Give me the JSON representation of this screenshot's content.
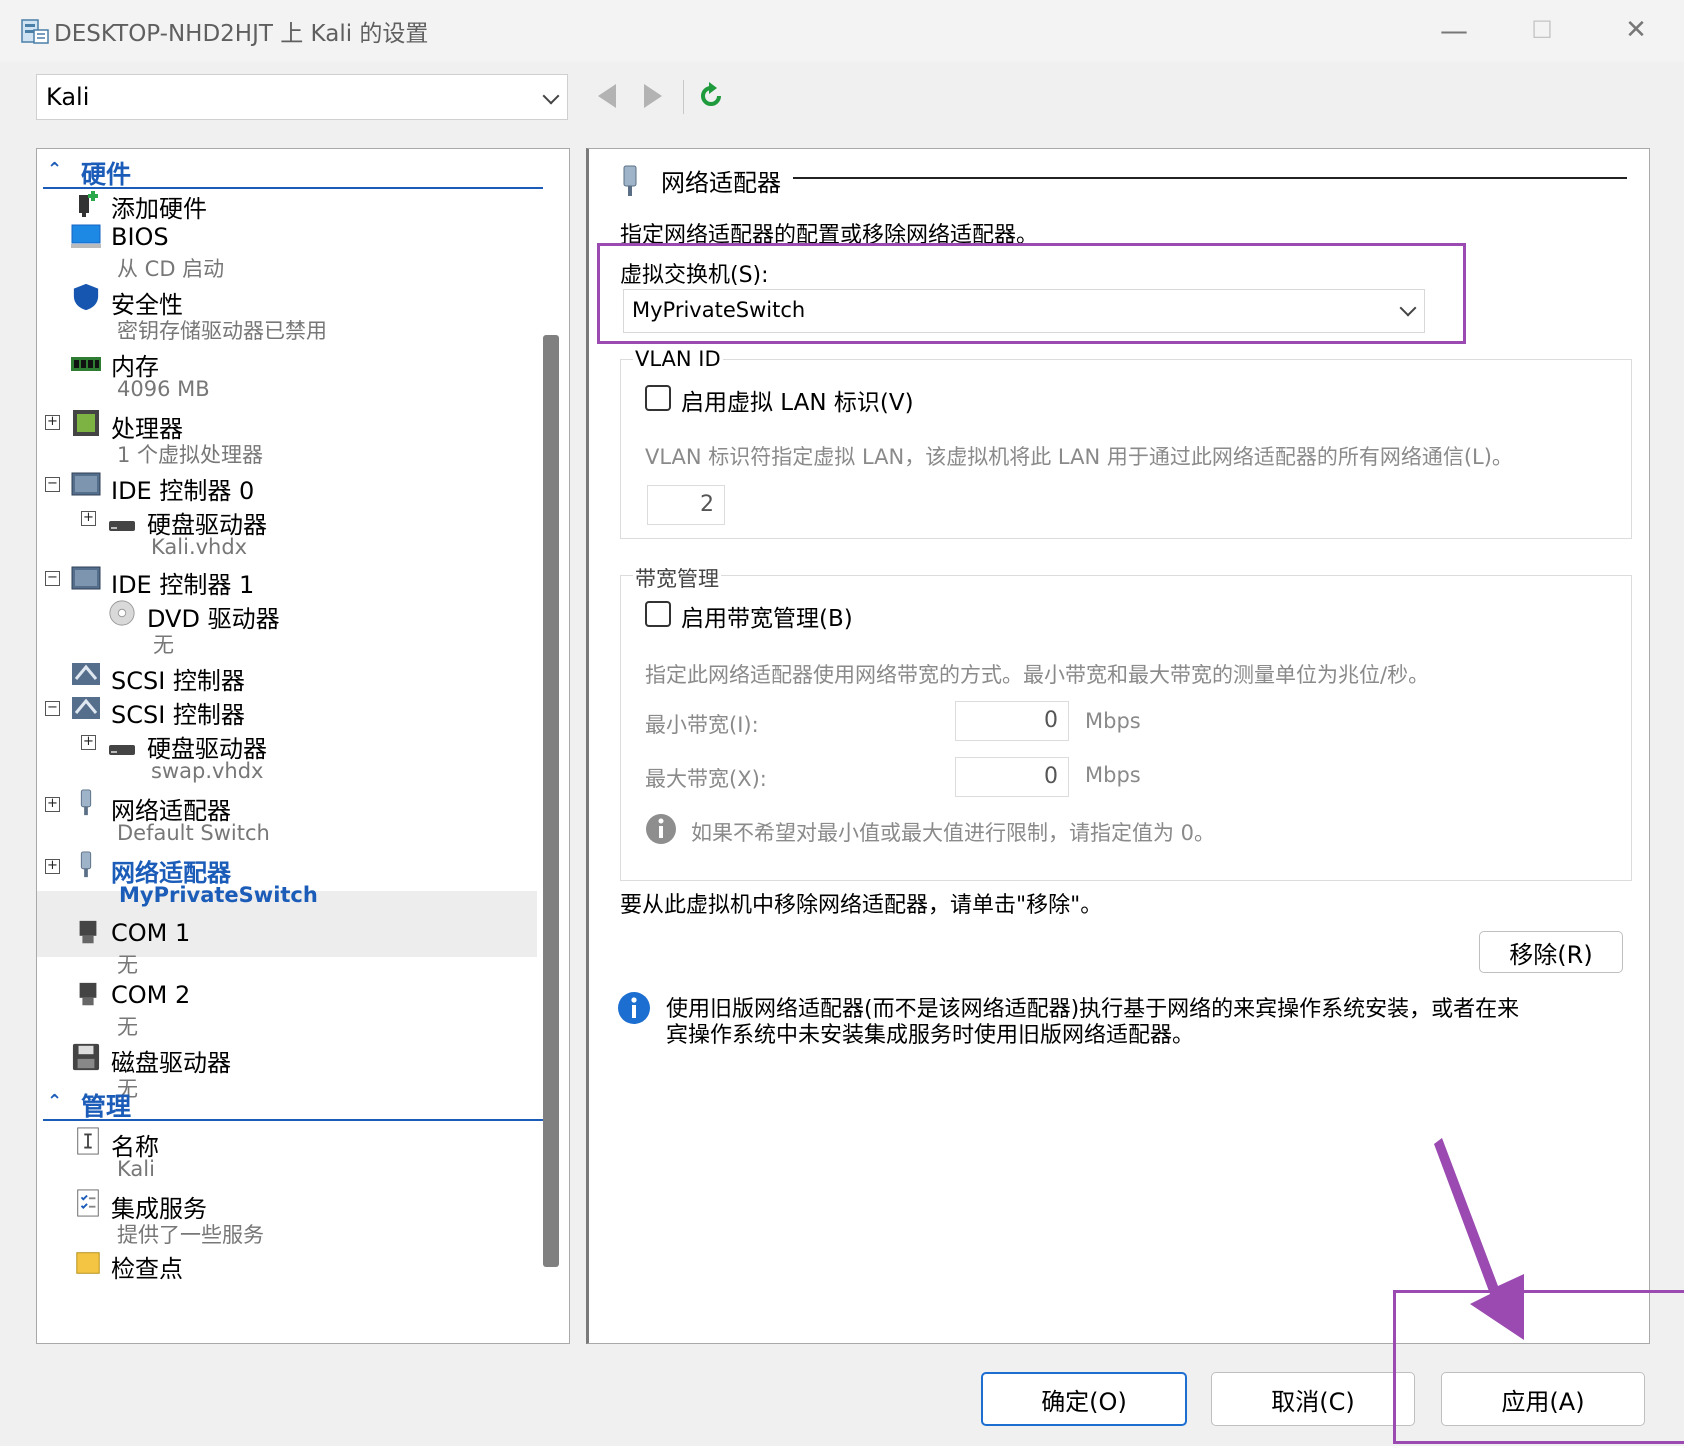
{
  "window": {
    "title": "DESKTOP-NHD2HJT 上 Kali 的设置",
    "controls": {
      "minimize": "—",
      "maximize": "☐",
      "close": "✕"
    }
  },
  "toolbar": {
    "vm_selected": "Kali"
  },
  "tree": {
    "hardware_header": "硬件",
    "management_header": "管理",
    "items": {
      "add_hardware": "添加硬件",
      "bios": "BIOS",
      "bios_sub": "从 CD 启动",
      "security": "安全性",
      "security_sub": "密钥存储驱动器已禁用",
      "memory": "内存",
      "memory_sub": "4096 MB",
      "processor": "处理器",
      "processor_sub": "1 个虚拟处理器",
      "ide0": "IDE 控制器 0",
      "hdd1": "硬盘驱动器",
      "hdd1_sub": "Kali.vhdx",
      "ide1": "IDE 控制器 1",
      "dvd": "DVD 驱动器",
      "dvd_sub": "无",
      "scsi1": "SCSI 控制器",
      "scsi2": "SCSI 控制器",
      "hdd2": "硬盘驱动器",
      "hdd2_sub": "swap.vhdx",
      "net1": "网络适配器",
      "net1_sub": "Default Switch",
      "net2": "网络适配器",
      "net2_sub": "MyPrivateSwitch",
      "com1": "COM 1",
      "com1_sub": "无",
      "com2": "COM 2",
      "com2_sub": "无",
      "floppy": "磁盘驱动器",
      "floppy_sub": "无",
      "name": "名称",
      "name_sub": "Kali",
      "integration": "集成服务",
      "integration_sub": "提供了一些服务",
      "checkpoint": "检查点"
    }
  },
  "panel": {
    "heading": "网络适配器",
    "description": "指定网络适配器的配置或移除网络适配器。",
    "switch_label": "虚拟交换机(S):",
    "switch_value": "MyPrivateSwitch",
    "vlan_title": "VLAN ID",
    "vlan_checkbox": "启用虚拟 LAN 标识(V)",
    "vlan_desc": "VLAN 标识符指定虚拟 LAN，该虚拟机将此 LAN 用于通过此网络适配器的所有网络通信(L)。",
    "vlan_value": "2",
    "bw_title": "带宽管理",
    "bw_checkbox": "启用带宽管理(B)",
    "bw_desc": "指定此网络适配器使用网络带宽的方式。最小带宽和最大带宽的测量单位为兆位/秒。",
    "min_label": "最小带宽(I):",
    "min_value": "0",
    "max_label": "最大带宽(X):",
    "max_value": "0",
    "unit": "Mbps",
    "bw_note": "如果不希望对最小值或最大值进行限制，请指定值为 0。",
    "remove_text": "要从此虚拟机中移除网络适配器，请单击\"移除\"。",
    "remove_button": "移除(R)",
    "info_line1": "使用旧版网络适配器(而不是该网络适配器)执行基于网络的来宾操作系统安装，或者在来",
    "info_line2": "宾操作系统中未安装集成服务时使用旧版网络适配器。"
  },
  "buttons": {
    "ok": "确定(O)",
    "cancel": "取消(C)",
    "apply": "应用(A)"
  },
  "colors": {
    "selected_text": "#1a5cb8",
    "annotation": "#9a4ab0",
    "refresh_icon": "#1f9a3c",
    "info_icon": "#1c6fd1"
  }
}
